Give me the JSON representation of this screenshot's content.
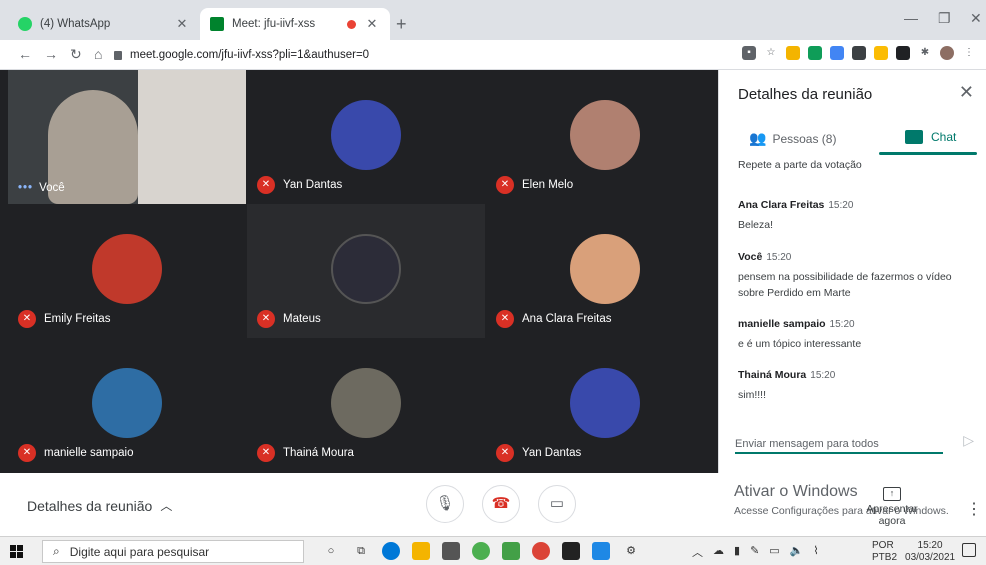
{
  "browser": {
    "tabs": [
      {
        "title": "(4) WhatsApp",
        "favicon_color": "#25d366"
      },
      {
        "title": "Meet: jfu-iivf-xss",
        "favicon_color": "#00832d"
      }
    ],
    "url": "meet.google.com/jfu-iivf-xss?pli=1&authuser=0"
  },
  "meeting": {
    "participants": [
      {
        "name": "Você",
        "muted": false,
        "avatar_color": "#a89f94"
      },
      {
        "name": "Yan Dantas",
        "muted": true,
        "avatar_color": "#3949ab"
      },
      {
        "name": "Elen Melo",
        "muted": true,
        "avatar_color": "#b08070"
      },
      {
        "name": "Emily Freitas",
        "muted": true,
        "avatar_color": "#c0392b"
      },
      {
        "name": "Mateus",
        "muted": true,
        "avatar_color": "#2c2c38"
      },
      {
        "name": "Ana Clara Freitas",
        "muted": true,
        "avatar_color": "#d9a07a"
      },
      {
        "name": "manielle sampaio",
        "muted": true,
        "avatar_color": "#2e6da4"
      },
      {
        "name": "Thainá Moura",
        "muted": true,
        "avatar_color": "#6d6a60"
      },
      {
        "name": "Yan Dantas",
        "muted": true,
        "avatar_color": "#3949ab"
      }
    ]
  },
  "panel": {
    "title": "Detalhes da reunião",
    "tab_people": "Pessoas (8)",
    "tab_chat": "Chat",
    "messages": [
      {
        "sender": "",
        "time": "",
        "text": "Repete a parte da votação"
      },
      {
        "sender": "Ana Clara Freitas",
        "time": "15:20",
        "text": "Beleza!"
      },
      {
        "sender": "Você",
        "time": "15:20",
        "text": "pensem na possibilidade de fazermos o vídeo sobre Perdido em Marte"
      },
      {
        "sender": "manielle sampaio",
        "time": "15:20",
        "text": "e é um tópico interessante"
      },
      {
        "sender": "Thainá Moura",
        "time": "15:20",
        "text": "sim!!!!"
      }
    ],
    "input_placeholder": "Enviar mensagem para todos"
  },
  "bottombar": {
    "details_label": "Detalhes da reunião",
    "activate_title": "Ativar o Windows",
    "activate_text": "Acesse Configurações para ativar o Windows.",
    "present_label": "Apresentar agora"
  },
  "taskbar": {
    "search_placeholder": "Digite aqui para pesquisar",
    "lang_top": "POR",
    "lang_bottom": "PTB2",
    "time": "15:20",
    "date": "03/03/2021"
  }
}
